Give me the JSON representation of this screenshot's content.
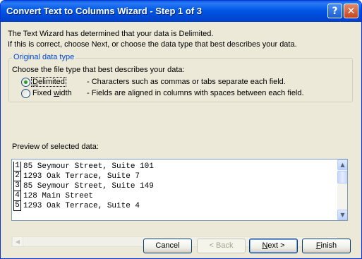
{
  "window": {
    "title": "Convert Text to Columns Wizard - Step 1 of 3",
    "help_glyph": "?",
    "close_glyph": "✕"
  },
  "intro": {
    "line1": "The Text Wizard has determined that your data is Delimited.",
    "line2": "If this is correct, choose Next, or choose the data type that best describes your data."
  },
  "data_type": {
    "group_label": "Original data type",
    "prompt": "Choose the file type that best describes your data:",
    "options": [
      {
        "label_u": "D",
        "label_rest": "elimited",
        "description": "- Characters such as commas or tabs separate each field.",
        "selected": true
      },
      {
        "label_pre": "Fixed ",
        "label_u": "w",
        "label_rest": "idth",
        "description": "- Fields are aligned in columns with spaces between each field.",
        "selected": false
      }
    ]
  },
  "preview": {
    "label": "Preview of selected data:",
    "rows": [
      {
        "num": "1",
        "text": "85 Seymour Street, Suite 101"
      },
      {
        "num": "2",
        "text": "1293 Oak Terrace, Suite 7"
      },
      {
        "num": "3",
        "text": "85 Seymour Street, Suite 149"
      },
      {
        "num": "4",
        "text": "128 Main Street"
      },
      {
        "num": "5",
        "text": "1293 Oak Terrace, Suite 4"
      }
    ],
    "scroll_up": "▲",
    "scroll_down": "▼",
    "scroll_left": "◀",
    "scroll_right": "▶"
  },
  "buttons": {
    "cancel": "Cancel",
    "back": "< Back",
    "next_u": "N",
    "next_rest": "ext >",
    "finish_u": "F",
    "finish_rest": "inish"
  },
  "colors": {
    "titlebar": "#0058e6",
    "dialog_bg": "#ece9d8",
    "group_label": "#0046d5",
    "radio_selected": "#21a121"
  },
  "icons": [
    "help-icon",
    "close-icon",
    "scroll-up-icon",
    "scroll-down-icon",
    "scroll-left-icon",
    "scroll-right-icon"
  ]
}
